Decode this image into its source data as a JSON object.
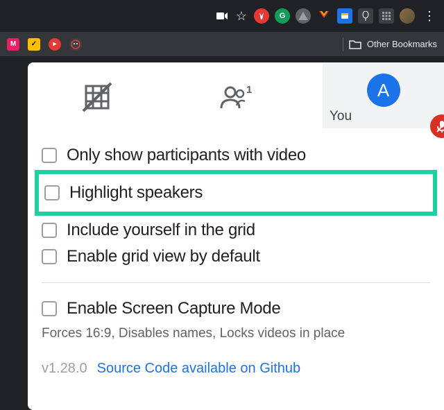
{
  "bookmarks_bar": {
    "other_bookmarks": "Other Bookmarks"
  },
  "tile": {
    "you_label": "You",
    "avatar_letter": "A"
  },
  "options": {
    "only_video": "Only show participants with video",
    "highlight_speakers": "Highlight speakers",
    "include_yourself": "Include yourself in the grid",
    "enable_default": "Enable grid view by default",
    "screen_capture": "Enable Screen Capture Mode",
    "screen_capture_sub": "Forces 16:9, Disables names, Locks videos in place"
  },
  "footer": {
    "version": "v1.28.0",
    "source_link": "Source Code available on Github"
  }
}
